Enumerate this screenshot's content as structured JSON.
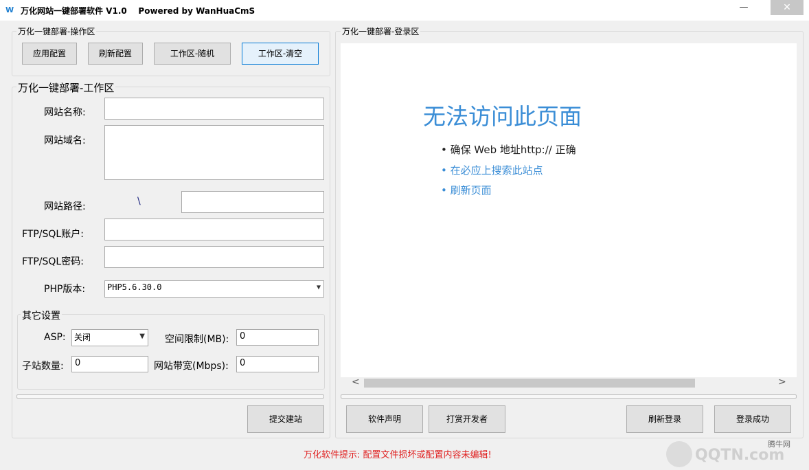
{
  "window": {
    "title": "万化网站一键部署软件 V1.0    Powered by WanHuaCmS",
    "minimize": "—",
    "close": "✕"
  },
  "operations": {
    "group_label": "万化一键部署-操作区",
    "buttons": [
      "应用配置",
      "刷新配置",
      "工作区-随机",
      "工作区-清空"
    ]
  },
  "workspace": {
    "group_label": "万化一键部署-工作区",
    "site_name_label": "网站名称:",
    "site_domain_label": "网站域名:",
    "site_path_label": "网站路径:",
    "path_separator": "\\",
    "ftp_account_label": "FTP/SQL账户:",
    "ftp_password_label": "FTP/SQL密码:",
    "php_label": "PHP版本:",
    "php_value": "PHP5.6.30.0"
  },
  "other_settings": {
    "group_label": "其它设置",
    "asp_label": "ASP:",
    "asp_value": "关闭",
    "space_label": "空间限制(MB):",
    "space_value": "0",
    "subsite_label": "子站数量:",
    "subsite_value": "0",
    "bandwidth_label": "网站带宽(Mbps):",
    "bandwidth_value": "0"
  },
  "submit_label": "提交建站",
  "login_area": {
    "group_label": "万化一键部署-登录区",
    "error_title": "无法访问此页面",
    "bullets": [
      "确保 Web 地址http:// 正确",
      "在必应上搜索此站点",
      "刷新页面"
    ],
    "scroll_left": "<",
    "scroll_right": ">"
  },
  "bottom_buttons": [
    "软件声明",
    "打赏开发者",
    "刷新登录",
    "登录成功"
  ],
  "status_message": "万化软件提示: 配置文件损坏或配置内容未编辑!",
  "watermark": {
    "site": "腾牛网",
    "logo": "QQTN.com"
  },
  "colors": {
    "accent": "#3a8dd6",
    "status": "#e02020"
  }
}
